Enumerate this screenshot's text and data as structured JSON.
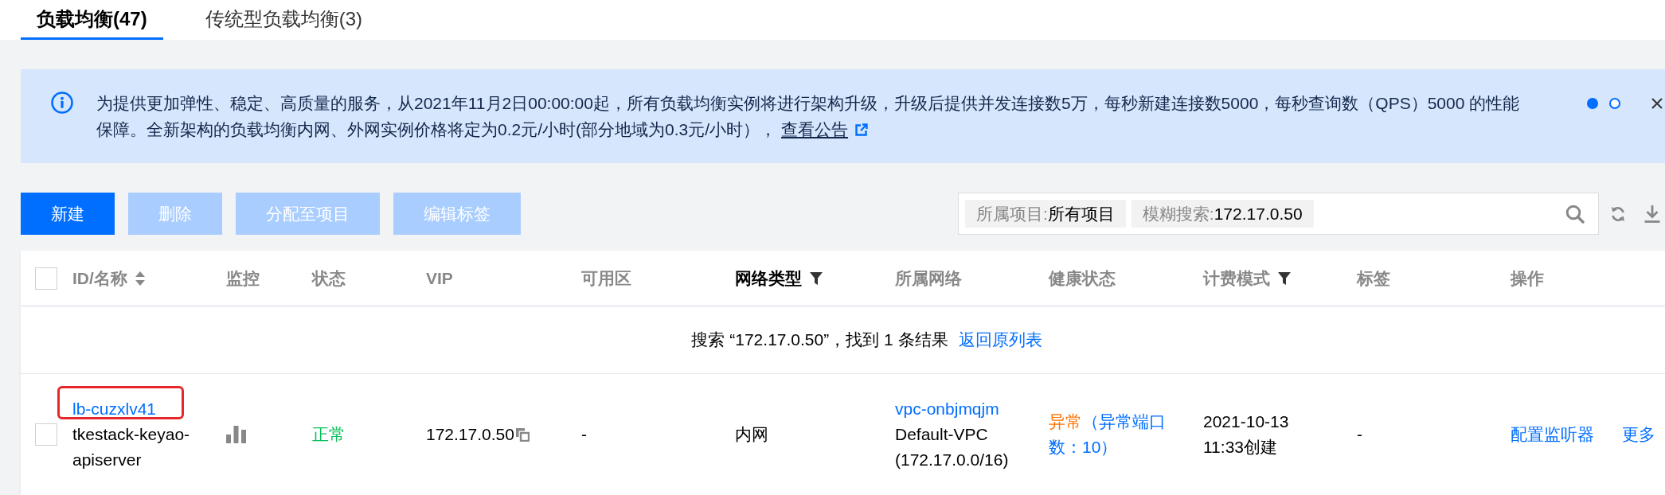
{
  "tabs": [
    {
      "label": "负载均衡(47)",
      "selected": true
    },
    {
      "label": "传统型负载均衡(3)",
      "selected": false
    }
  ],
  "notice": {
    "text": "为提供更加弹性、稳定、高质量的服务，从2021年11月2日00:00:00起，所有负载均衡实例将进行架构升级，升级后提供并发连接数5万，每秒新建连接数5000，每秒查询数（QPS）5000 的性能保障。全新架构的负载均衡内网、外网实例价格将定为0.2元/小时(部分地域为0.3元/小时），",
    "link": "查看公告",
    "pages": [
      {
        "selected": true
      },
      {
        "selected": false
      }
    ]
  },
  "toolbar": {
    "buttons": [
      {
        "label": "新建",
        "disabled": false
      },
      {
        "label": "删除",
        "disabled": true
      },
      {
        "label": "分配至项目",
        "disabled": true
      },
      {
        "label": "编辑标签",
        "disabled": true
      }
    ],
    "search": {
      "tags": [
        {
          "key": "所属项目:",
          "value": "所有项目"
        },
        {
          "key": "模糊搜索:",
          "value": "172.17.0.50"
        }
      ]
    }
  },
  "table": {
    "select_all": {
      "checked": false
    },
    "columns": [
      {
        "label": "ID/名称",
        "kind": "sort",
        "active": false
      },
      {
        "label": "监控",
        "kind": "plain",
        "active": false
      },
      {
        "label": "状态",
        "kind": "plain",
        "active": false
      },
      {
        "label": "VIP",
        "kind": "plain",
        "active": false
      },
      {
        "label": "可用区",
        "kind": "plain",
        "active": false
      },
      {
        "label": "网络类型",
        "kind": "filter",
        "active": true
      },
      {
        "label": "所属网络",
        "kind": "plain",
        "active": false
      },
      {
        "label": "健康状态",
        "kind": "plain",
        "active": false
      },
      {
        "label": "计费模式",
        "kind": "filter",
        "active": false
      },
      {
        "label": "标签",
        "kind": "plain",
        "active": false
      },
      {
        "label": "操作",
        "kind": "plain",
        "active": false
      }
    ],
    "search_result": {
      "text": "搜索 “172.17.0.50”，找到 1 条结果",
      "link": "返回原列表"
    },
    "rows": [
      {
        "checked": false,
        "id": "lb-cuzxlv41",
        "id_highlighted": true,
        "name": "tkestack-keyao-apiserver",
        "status": {
          "text": "正常",
          "alert": false
        },
        "vip": "172.17.0.50",
        "zone": "-",
        "network_type": "内网",
        "vpc": {
          "id": "vpc-onbjmqjm",
          "name": "Default-VPC",
          "cidr": "(172.17.0.0/16)"
        },
        "health": {
          "text": "异常",
          "alert": true,
          "detail": "（异常端口数：10）"
        },
        "billing": "2021-10-13 11:33创建",
        "tags": "-",
        "actions": [
          "配置监听器",
          "更多"
        ]
      }
    ]
  }
}
